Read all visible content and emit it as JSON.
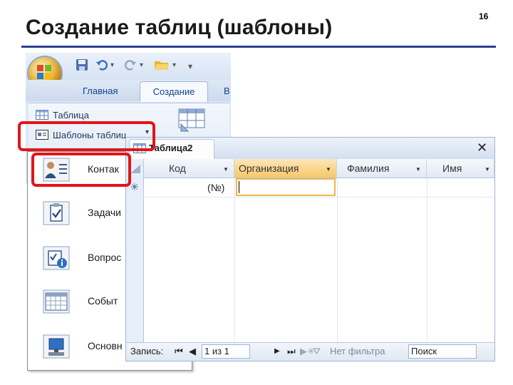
{
  "slide": {
    "title": "Создание таблиц (шаблоны)",
    "page_number": "16"
  },
  "ribbon": {
    "tabs": [
      "Главная",
      "Создание",
      "В"
    ],
    "active_tab": "Создание",
    "items": {
      "table": "Таблица",
      "templates": "Шаблоны таблиц"
    }
  },
  "templates_menu": {
    "items": [
      {
        "label": "Контак",
        "icon": "contacts-icon"
      },
      {
        "label": "Задачи",
        "icon": "tasks-icon"
      },
      {
        "label": "Вопрос",
        "icon": "issues-icon"
      },
      {
        "label": "Событ",
        "icon": "events-icon"
      },
      {
        "label": "Основн",
        "icon": "assets-icon"
      }
    ]
  },
  "table_window": {
    "title": "Таблица2",
    "columns": [
      "Код",
      "Организация",
      "Фамилия",
      "Имя"
    ],
    "selected_column": "Организация",
    "new_row_marker": "✳",
    "new_row_code": "(№)"
  },
  "navigation": {
    "record_label": "Запись:",
    "position": "1 из 1",
    "filter": "Нет фильтра",
    "search": "Поиск"
  },
  "colors": {
    "accent": "#2c3f96",
    "highlight": "#e0161a",
    "selected_column": "#f6c86b"
  }
}
